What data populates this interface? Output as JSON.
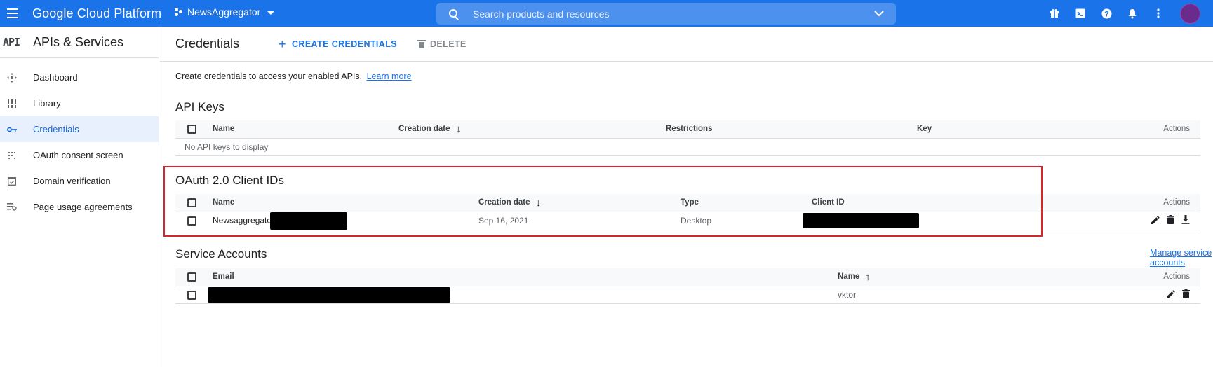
{
  "topbar": {
    "brand": "Google Cloud Platform",
    "project": "NewsAggregator",
    "search_placeholder": "Search products and resources",
    "icons": [
      "gift-icon",
      "terminal-icon",
      "help-icon",
      "notifications-icon",
      "more-vert-icon"
    ],
    "colors": {
      "bar": "#1a73e8",
      "avatar": "#6b2b8c"
    }
  },
  "sidebar": {
    "logo": "API",
    "title": "APIs & Services",
    "items": [
      {
        "label": "Dashboard",
        "icon": "dashboard-icon",
        "active": false
      },
      {
        "label": "Library",
        "icon": "library-icon",
        "active": false
      },
      {
        "label": "Credentials",
        "icon": "key-icon",
        "active": true
      },
      {
        "label": "OAuth consent screen",
        "icon": "oauth-consent-icon",
        "active": false
      },
      {
        "label": "Domain verification",
        "icon": "domain-verification-icon",
        "active": false
      },
      {
        "label": "Page usage agreements",
        "icon": "page-usage-icon",
        "active": false
      }
    ]
  },
  "header": {
    "title": "Credentials",
    "create_label": "CREATE CREDENTIALS",
    "delete_label": "DELETE"
  },
  "intro": {
    "text": "Create credentials to access your enabled APIs.",
    "link": "Learn more"
  },
  "api_keys": {
    "title": "API Keys",
    "columns": [
      "Name",
      "Creation date",
      "Restrictions",
      "Key",
      "Actions"
    ],
    "empty_text": "No API keys to display"
  },
  "oauth": {
    "title": "OAuth 2.0 Client IDs",
    "columns": [
      "Name",
      "Creation date",
      "Type",
      "Client ID",
      "Actions"
    ],
    "rows": [
      {
        "name": "Newsaggregato",
        "creation_date": "Sep 16, 2021",
        "type": "Desktop"
      }
    ]
  },
  "service_accounts": {
    "title": "Service Accounts",
    "manage_link": "Manage service accounts",
    "columns": [
      "Email",
      "Name",
      "Actions"
    ],
    "rows": [
      {
        "name": "vktor"
      }
    ]
  }
}
